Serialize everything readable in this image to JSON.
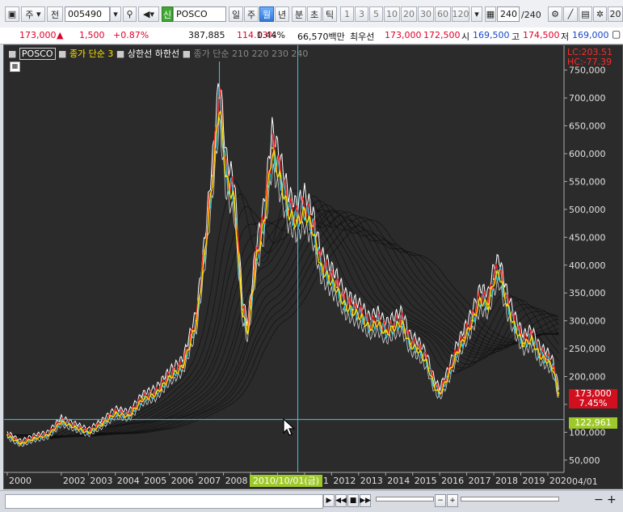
{
  "toolbar": {
    "market_label": "주",
    "market_btn": "전",
    "code": "005490",
    "new_label": "신",
    "name": "POSCO",
    "periods": [
      "일",
      "주",
      "월",
      "년"
    ],
    "period_selected": "월",
    "sub_periods": [
      "분",
      "초",
      "틱"
    ],
    "intervals": [
      "1",
      "3",
      "5",
      "10",
      "20",
      "30",
      "60",
      "120"
    ],
    "count_value": "240",
    "count_total": "/240",
    "corner_text": "20"
  },
  "price_bar": {
    "price": "173,000",
    "arrow": "▲",
    "change": "1,500",
    "change_pct": "+0.87%",
    "volume": "387,885",
    "volume_ratio": "114.13%",
    "turnover_pct": "0.44%",
    "amount": "66,570백만",
    "best_label": "최우선",
    "best_ask": "173,000",
    "best_bid": "172,500",
    "open_label": "시",
    "open": "169,500",
    "high_label": "고",
    "high": "174,500",
    "low_label": "저",
    "low": "169,000"
  },
  "legend": {
    "stock": "POSCO",
    "ma_item": "종가 단순 3",
    "upper": "상한선",
    "lower": "하한선",
    "ribbon": "종가 단순 210  220  230  240"
  },
  "readouts": {
    "lc": "LC:203.51",
    "hc": "HC:-77.39",
    "last_price": "173,000",
    "last_pct": "7.45%",
    "cross_price": "122,961",
    "cross_date": "2010/10/01(금)",
    "axis_right_date": "04/01"
  },
  "chart_data": {
    "type": "line",
    "x_ticks": [
      "2000",
      "2002",
      "2003",
      "2004",
      "2005",
      "2006",
      "2007",
      "2008",
      "2009",
      "2010",
      "2011",
      "2012",
      "2013",
      "2014",
      "2015",
      "2016",
      "2017",
      "2018",
      "2019",
      "2020"
    ],
    "y_ticks": [
      50000,
      100000,
      150000,
      200000,
      250000,
      300000,
      350000,
      400000,
      450000,
      500000,
      550000,
      600000,
      650000,
      700000,
      750000
    ],
    "y_tick_labels": [
      "50,000",
      "100,000",
      "150,000",
      "200,000",
      "250,000",
      "300,000",
      "350,000",
      "400,000",
      "450,000",
      "500,000",
      "550,000",
      "600,000",
      "650,000",
      "700,000",
      "750,000"
    ],
    "ylim": [
      28000,
      780000
    ],
    "xlim": [
      2000.0,
      2020.6
    ],
    "series": [
      {
        "name": "종가 단순 3",
        "x": [
          2000.0,
          2000.5,
          2001.0,
          2001.5,
          2002.0,
          2002.5,
          2003.0,
          2003.5,
          2004.0,
          2004.5,
          2005.0,
          2005.5,
          2006.0,
          2006.5,
          2007.0,
          2007.3,
          2007.6,
          2007.85,
          2008.1,
          2008.4,
          2008.7,
          2008.9,
          2009.2,
          2009.5,
          2009.8,
          2010.1,
          2010.4,
          2010.7,
          2011.0,
          2011.3,
          2011.6,
          2011.9,
          2012.2,
          2012.5,
          2012.8,
          2013.1,
          2013.4,
          2013.7,
          2014.0,
          2014.3,
          2014.6,
          2014.9,
          2015.2,
          2015.5,
          2015.8,
          2016.0,
          2016.3,
          2016.6,
          2016.9,
          2017.2,
          2017.5,
          2017.8,
          2018.0,
          2018.2,
          2018.5,
          2018.8,
          2019.1,
          2019.4,
          2019.7,
          2020.0,
          2020.2,
          2020.4
        ],
        "values": [
          95000,
          80000,
          90000,
          95000,
          120000,
          110000,
          100000,
          115000,
          135000,
          130000,
          160000,
          170000,
          200000,
          220000,
          300000,
          420000,
          560000,
          700000,
          560000,
          520000,
          320000,
          280000,
          410000,
          480000,
          610000,
          560000,
          500000,
          480000,
          500000,
          470000,
          400000,
          380000,
          360000,
          330000,
          320000,
          310000,
          290000,
          300000,
          280000,
          290000,
          300000,
          260000,
          250000,
          230000,
          185000,
          170000,
          200000,
          240000,
          270000,
          300000,
          340000,
          330000,
          375000,
          390000,
          330000,
          290000,
          260000,
          270000,
          240000,
          230000,
          215000,
          170000
        ]
      }
    ],
    "grid": false,
    "legend_position": "top-left"
  },
  "bottom": {
    "buttons": [
      "▶",
      "◀◀",
      "■",
      "▶▶"
    ],
    "zoom_buttons": [
      "−",
      "+",
      "−",
      "+"
    ]
  },
  "colors": {
    "bg": "#2b2b2b",
    "price_up": "#e0002a",
    "price_down": "#1646c8",
    "ma_line": "#ffe400",
    "upper_line": "#ffffff",
    "cross_hair": "#3cc8e6",
    "date_highlight": "#9ec92a"
  }
}
